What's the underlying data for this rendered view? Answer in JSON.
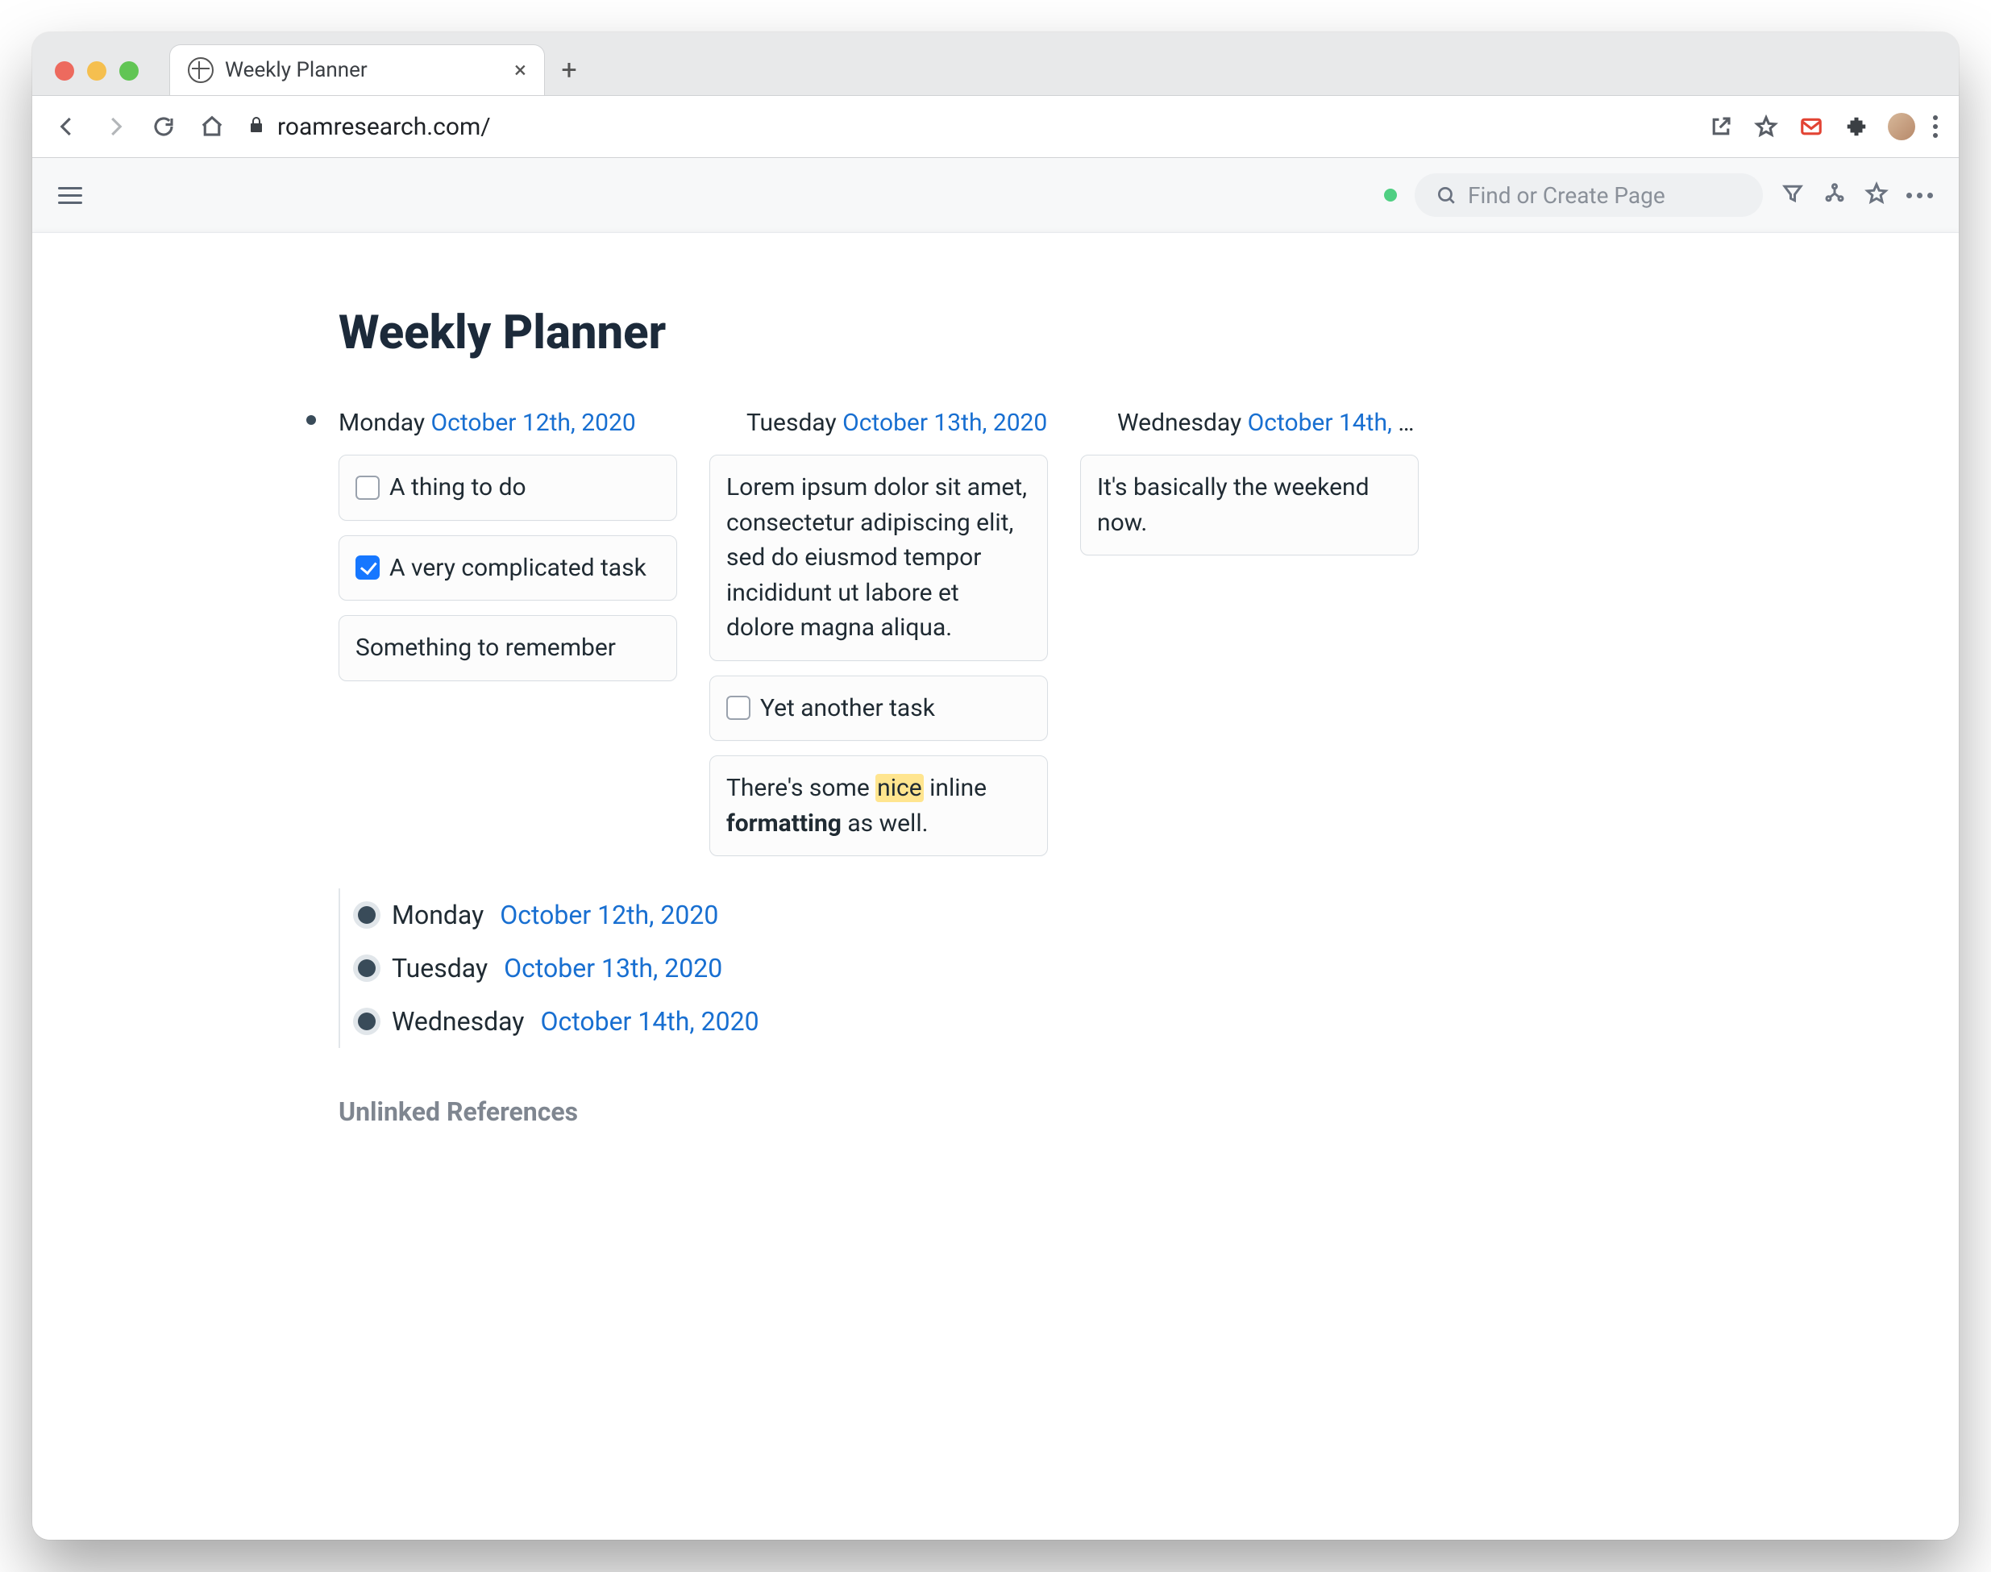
{
  "browser": {
    "tab_title": "Weekly Planner",
    "url": "roamresearch.com/"
  },
  "app": {
    "search_placeholder": "Find or Create Page",
    "page_title": "Weekly Planner",
    "unlinked_label": "Unlinked References"
  },
  "kanban": {
    "columns": [
      {
        "day": "Monday",
        "date": "October 12th, 2020",
        "cards": [
          {
            "type": "todo",
            "checked": false,
            "text": "A thing to do"
          },
          {
            "type": "todo",
            "checked": true,
            "text": "A very complicated task"
          },
          {
            "type": "text",
            "text": "Something to remember"
          }
        ]
      },
      {
        "day": "Tuesday",
        "date": "October 13th, 2020",
        "cards": [
          {
            "type": "text",
            "text": "Lorem ipsum dolor sit amet, consectetur adipiscing elit, sed do eiusmod tempor incididunt ut labore et dolore magna aliqua."
          },
          {
            "type": "todo",
            "checked": false,
            "text": "Yet another task"
          },
          {
            "type": "rich",
            "prefix": "There's some ",
            "highlight": "nice",
            "mid": " inline ",
            "bold": "formatting",
            "suffix": " as well."
          }
        ]
      },
      {
        "day": "Wednesday",
        "date": "October 14th, 20…",
        "date_full": "October 14th, 2020",
        "cards": [
          {
            "type": "text",
            "text": "It's basically the weekend now."
          }
        ]
      }
    ]
  },
  "references": [
    {
      "day": "Monday",
      "date": "October 12th, 2020"
    },
    {
      "day": "Tuesday",
      "date": "October 13th, 2020"
    },
    {
      "day": "Wednesday",
      "date": "October 14th, 2020"
    }
  ]
}
